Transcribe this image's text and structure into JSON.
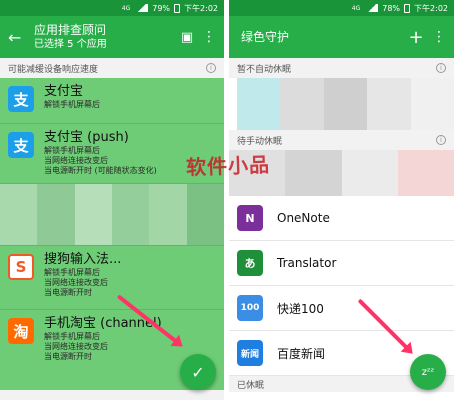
{
  "status": {
    "carrier": "4G",
    "battery": "79%",
    "time_left": "下午2:02",
    "battery_right": "78%",
    "time_right": "下午2:02"
  },
  "left": {
    "appbar": {
      "title": "应用排查顾问",
      "subtitle": "已选择 5 个应用",
      "back_icon": "arrow-left-icon",
      "action_icon": "hibernate-icon",
      "menu_icon": "more-vert-icon"
    },
    "section_label": "可能减缓设备响应速度",
    "apps": [
      {
        "name": "支付宝",
        "icon": "alipay-icon",
        "glyph": "支",
        "color": "#1c9ee8",
        "desc": [
          "解锁手机屏幕后"
        ]
      },
      {
        "name": "支付宝 (push)",
        "icon": "alipay-icon",
        "glyph": "支",
        "color": "#1c9ee8",
        "desc": [
          "解锁手机屏幕后",
          "当网络连接改变后",
          "当电源断开时 (可能随状态变化)"
        ]
      },
      {
        "name": "搜狗输入法...",
        "icon": "sogou-icon",
        "glyph": "S",
        "color": "#f15a24",
        "desc": [
          "解锁手机屏幕后",
          "当网络连接改变后",
          "当电源断开时"
        ]
      },
      {
        "name": "手机淘宝 (channel)",
        "icon": "taobao-icon",
        "glyph": "淘",
        "color": "#ff6a00",
        "desc": [
          "解锁手机屏幕后",
          "当网络连接改变后",
          "当电源断开时"
        ]
      }
    ],
    "fab_icon": "check-icon"
  },
  "right": {
    "appbar": {
      "title": "绿色守护",
      "add_icon": "plus-icon",
      "menu_icon": "more-vert-icon"
    },
    "section_no_auto": "暂不自动休眠",
    "section_manual": "待手动休眠",
    "section_bottom": "已休眠",
    "apps": [
      {
        "name": "OneNote",
        "icon": "onenote-icon",
        "glyph": "N",
        "color": "#7b2f9b"
      },
      {
        "name": "Translator",
        "icon": "translator-icon",
        "glyph": "あ",
        "color": "#1f8f3a"
      },
      {
        "name": "快递100",
        "icon": "kuaidi100-icon",
        "glyph": "100",
        "color": "#3a8ee6"
      },
      {
        "name": "百度新闻",
        "icon": "baidu-news-icon",
        "glyph": "新闻",
        "color": "#1e7fe0"
      }
    ],
    "fab_icon": "zzz-icon",
    "fab_glyph": "zᶻᶻ"
  },
  "watermark": "软件小品",
  "colors": {
    "status_bar": "#1a9438",
    "app_bar": "#27ae49",
    "list_selected": "#6ecb76",
    "accent_arrow": "#ff3366"
  }
}
